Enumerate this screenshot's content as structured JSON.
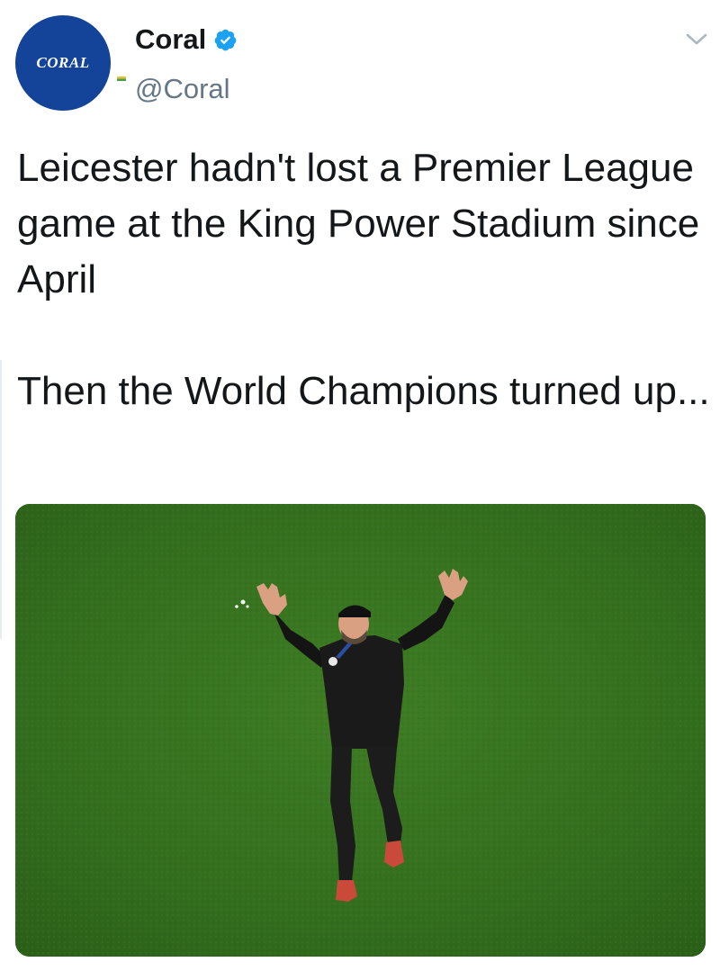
{
  "account": {
    "avatar_text": "CORAL",
    "display_name": "Coral",
    "handle": "@Coral",
    "verified": true,
    "avatar_color": "#14449a",
    "verified_color": "#1da1f2"
  },
  "tweet": {
    "text": "Leicester hadn't lost a Premier League game at the King Power Stadium since April\n\nThen the World Champions turned up..."
  },
  "media": {
    "kind": "photo",
    "subject": "man in black tracksuit waving both arms on a football pitch",
    "pitch_color": "#2f6a1c"
  },
  "icons": {
    "verified": "verified-badge-icon",
    "menu": "chevron-down-icon"
  }
}
